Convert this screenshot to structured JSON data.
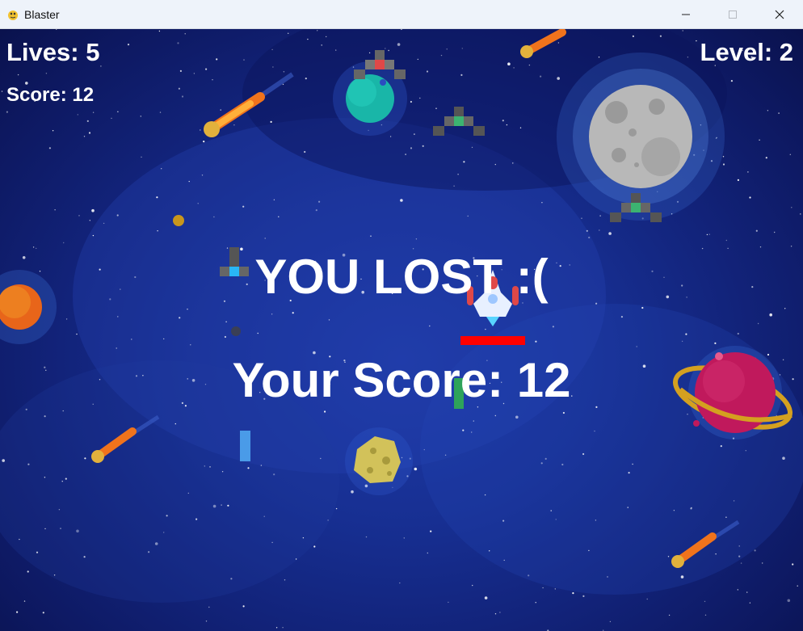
{
  "window": {
    "title": "Blaster",
    "app_icon": "pygame-snake-icon",
    "controls": [
      "minimize-icon",
      "maximize-icon",
      "close-icon"
    ]
  },
  "hud": {
    "lives_text": "Lives: 5",
    "score_text": "Score: 12",
    "level_text": "Level: 2"
  },
  "game_over": {
    "title": "YOU LOST :(",
    "score_text": "Your Score: 12"
  },
  "colors": {
    "background_center": "#1e3aa6",
    "background_edge": "#0a124d",
    "text": "#ffffff",
    "health_bar": "#ff0000",
    "enemy_green_core": "#3cb371",
    "enemy_red_core": "#e04848",
    "enemy_blue_core": "#29b6f6"
  }
}
